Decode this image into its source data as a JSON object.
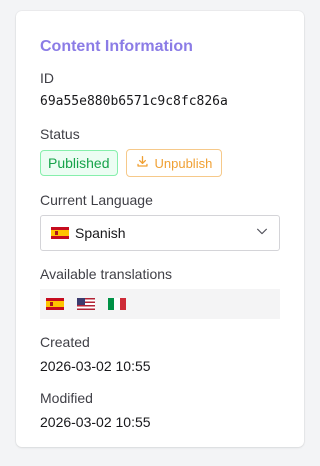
{
  "card": {
    "title": "Content Information"
  },
  "id_field": {
    "label": "ID",
    "value": "69a55e880b6571c9c8fc826a"
  },
  "status": {
    "label": "Status",
    "badge": "Published",
    "unpublish_label": "Unpublish",
    "badge_color": "#16a34a",
    "unpublish_color": "#f0a033"
  },
  "language": {
    "label": "Current Language",
    "selected": "Spanish",
    "selected_flag": "flag-es-icon"
  },
  "translations": {
    "label": "Available translations",
    "flags": [
      "flag-es-icon",
      "flag-us-icon",
      "flag-it-icon"
    ]
  },
  "created": {
    "label": "Created",
    "value": "2026-03-02 10:55"
  },
  "modified": {
    "label": "Modified",
    "value": "2026-03-02 10:55"
  },
  "colors": {
    "title": "#8b7ce6"
  }
}
